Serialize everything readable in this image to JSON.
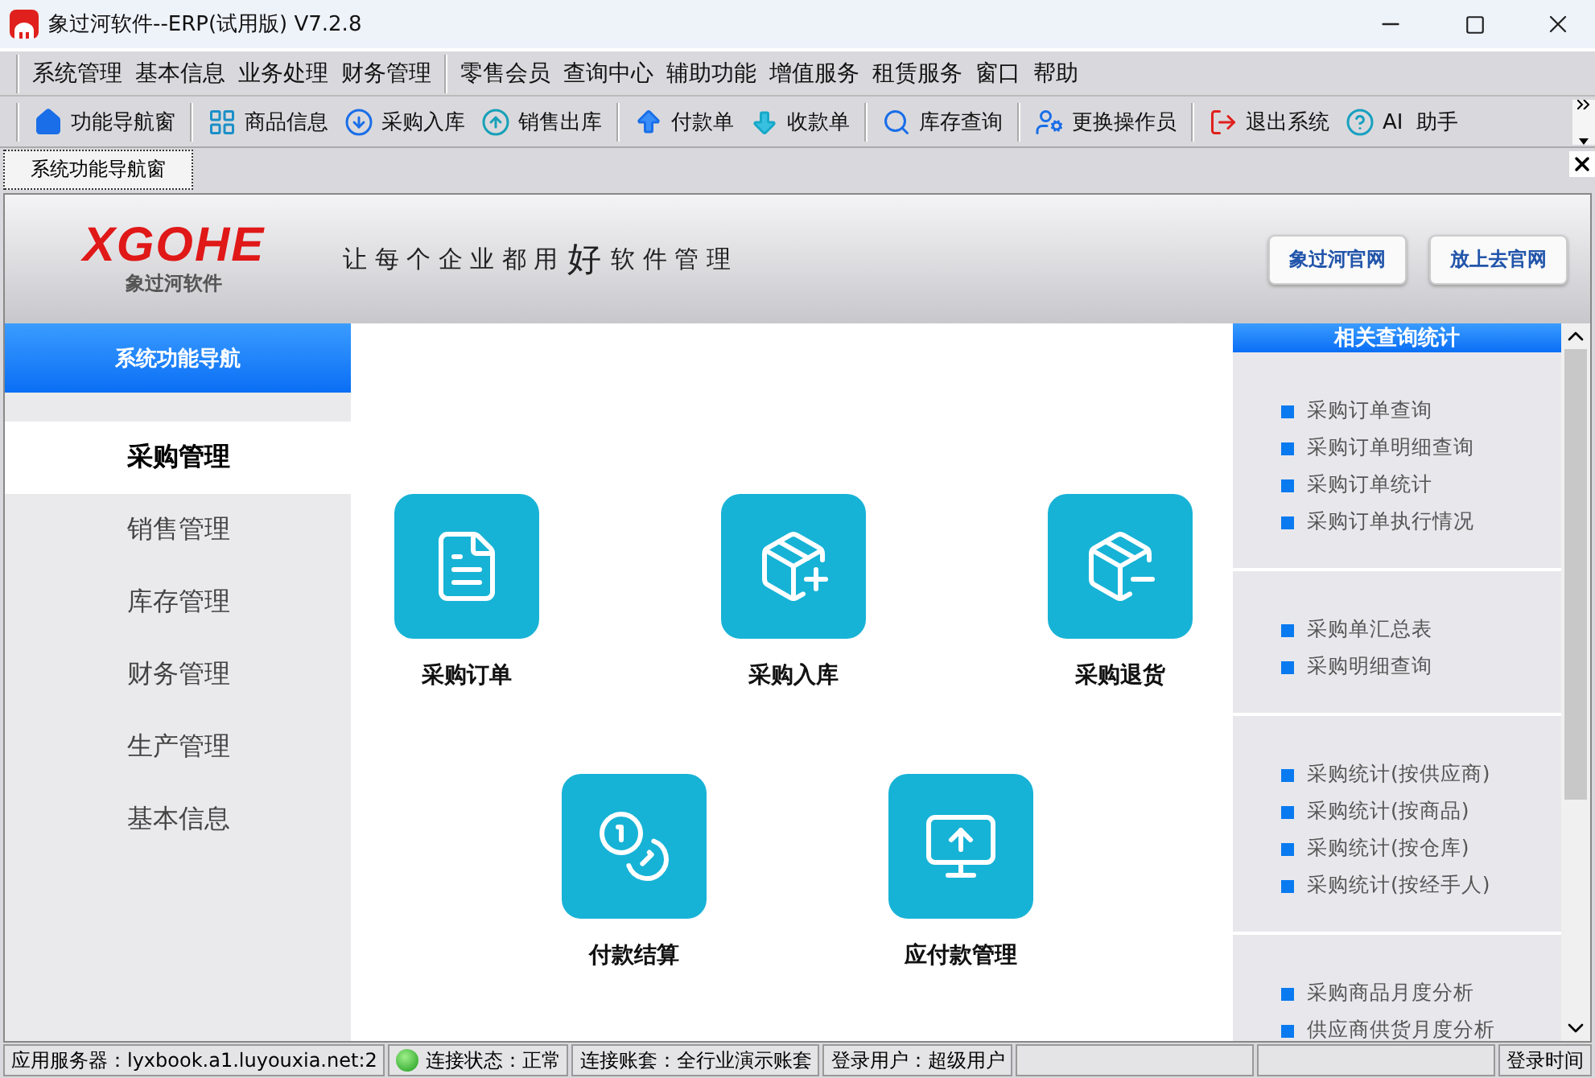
{
  "window": {
    "title": "象过河软件--ERP(试用版) V7.2.8"
  },
  "menu": [
    [
      "系统管理",
      "基本信息",
      "业务处理",
      "财务管理"
    ],
    [
      "零售会员",
      "查询中心",
      "辅助功能",
      "增值服务",
      "租赁服务",
      "窗口",
      "帮助"
    ]
  ],
  "toolbar": [
    [
      {
        "label": "功能导航窗",
        "kind": "home"
      }
    ],
    [
      {
        "label": "商品信息",
        "kind": "goods"
      },
      {
        "label": "采购入库",
        "kind": "in"
      },
      {
        "label": "销售出库",
        "kind": "out"
      }
    ],
    [
      {
        "label": "付款单",
        "kind": "pay"
      },
      {
        "label": "收款单",
        "kind": "receive"
      }
    ],
    [
      {
        "label": "库存查询",
        "kind": "search"
      }
    ],
    [
      {
        "label": "更换操作员",
        "kind": "user"
      }
    ],
    [
      {
        "label": "退出系统",
        "kind": "exit"
      },
      {
        "label": "AI  助手",
        "kind": "help"
      }
    ]
  ],
  "doc_tabs": [
    {
      "label": "系统功能导航窗",
      "selected": true
    }
  ],
  "banner": {
    "logo": "XGOHE",
    "logo_sub": "象过河软件",
    "slogan_before": "让 每 个 企 业 都 用",
    "slogan_big": "好",
    "slogan_after": "软 件 管 理",
    "links": [
      "象过河官网",
      "放上去官网"
    ]
  },
  "nav": {
    "title": "系统功能导航",
    "items": [
      {
        "label": "采购管理",
        "selected": true
      },
      {
        "label": "销售管理",
        "selected": false
      },
      {
        "label": "库存管理",
        "selected": false
      },
      {
        "label": "财务管理",
        "selected": false
      },
      {
        "label": "生产管理",
        "selected": false
      },
      {
        "label": "基本信息",
        "selected": false
      }
    ]
  },
  "tiles": [
    [
      {
        "label": "采购订单",
        "kind": "doc"
      },
      {
        "label": "采购入库",
        "kind": "box-plus"
      },
      {
        "label": "采购退货",
        "kind": "box-minus"
      }
    ],
    [
      {
        "label": "付款结算",
        "kind": "coins"
      },
      {
        "label": "应付款管理",
        "kind": "screen"
      }
    ]
  ],
  "related": {
    "title": "相关查询统计",
    "groups": [
      [
        "采购订单查询",
        "采购订单明细查询",
        "采购订单统计",
        "采购订单执行情况"
      ],
      [
        "采购单汇总表",
        "采购明细查询"
      ],
      [
        "采购统计(按供应商)",
        "采购统计(按商品)",
        "采购统计(按仓库)",
        "采购统计(按经手人)"
      ],
      [
        "采购商品月度分析",
        "供应商供货月度分析"
      ]
    ]
  },
  "status_bar": [
    {
      "label": "应用服务器：lyxbook.a1.luyouxia.net:2",
      "kind": "text"
    },
    {
      "label": "连接状态：正常",
      "kind": "led"
    },
    {
      "label": "连接账套：全行业演示账套",
      "kind": "text"
    },
    {
      "label": "登录用户：超级用户",
      "kind": "text"
    },
    {
      "kind": "empty"
    },
    {
      "kind": "empty"
    },
    {
      "label": "登录时间",
      "kind": "text"
    }
  ]
}
